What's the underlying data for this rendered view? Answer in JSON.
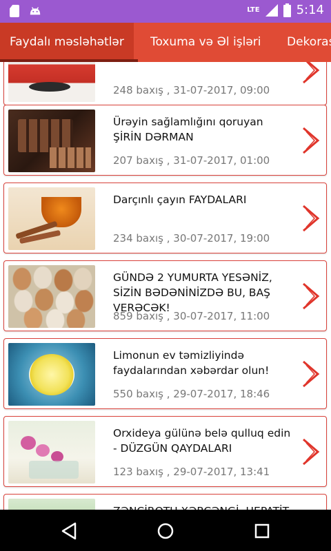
{
  "status_bar": {
    "lte": "LTE",
    "time": "5:14"
  },
  "tabs": [
    {
      "label": "Faydalı məsləhətlər",
      "active": true
    },
    {
      "label": "Toxuma və Əl işləri",
      "active": false
    },
    {
      "label": "Dekoras",
      "active": false
    }
  ],
  "colors": {
    "accent": "#e04b35",
    "status_bar": "#9b59d0",
    "card_border": "#d9413a"
  },
  "articles": [
    {
      "title": "",
      "views": "248 baxış",
      "date": "31-07-2017, 09:00",
      "meta": "248 baxış , 31-07-2017, 09:00"
    },
    {
      "title": "Ürəyin sağlamlığını qoruyan ŞİRİN DƏRMAN",
      "meta": "207 baxış , 31-07-2017, 01:00"
    },
    {
      "title": "Darçınlı çayın FAYDALARI",
      "meta": "234 baxış , 30-07-2017, 19:00"
    },
    {
      "title": "GÜNDƏ 2 YUMURTA YESƏNİZ, SİZİN BƏDƏNİNİZDƏ BU, BAŞ VERƏCƏK!",
      "meta": "859 baxış , 30-07-2017, 11:00"
    },
    {
      "title": "Limonun ev təmizliyində faydalarından xəbərdar olun!",
      "meta": "550 baxış , 29-07-2017, 18:46"
    },
    {
      "title": "Orxideya gülünə belə qulluq edin - DÜZGÜN QAYDALARI",
      "meta": "123 baxış , 29-07-2017, 13:41"
    },
    {
      "title": "ZƏNCİROTU XƏRÇƏNGİ, HEPATİT",
      "meta": ""
    }
  ],
  "icons": {
    "status": [
      "sd-card-icon",
      "android-icon",
      "signal-icon",
      "battery-icon"
    ],
    "nav": [
      "back-icon",
      "home-icon",
      "recents-icon"
    ],
    "card": "chevron-right-icon"
  }
}
